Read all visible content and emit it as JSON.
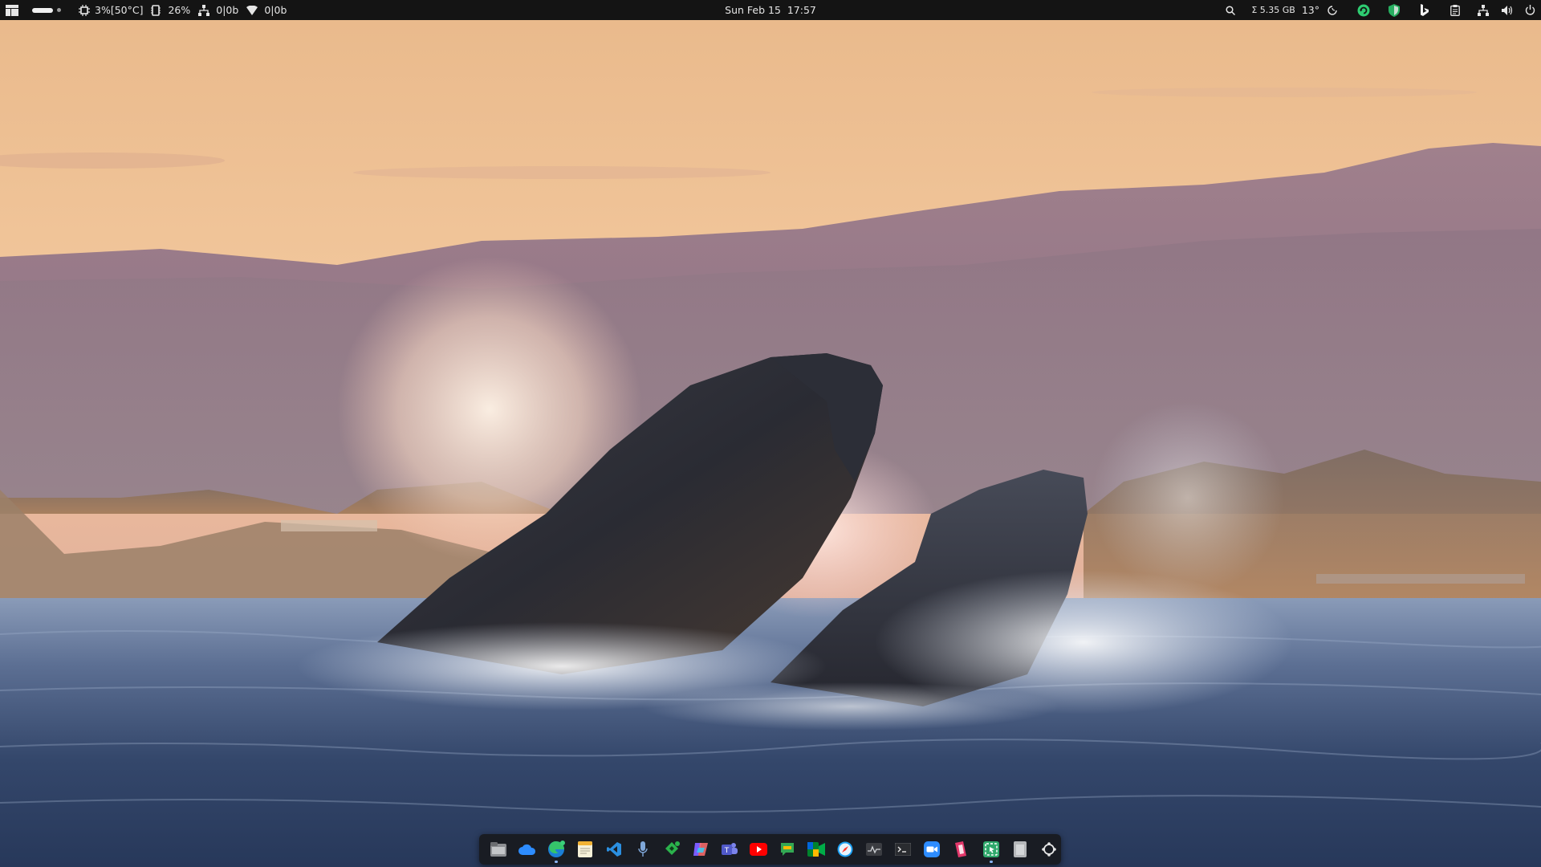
{
  "top_panel": {
    "cpu_usage": "3%[50°C]",
    "memory_usage": "26%",
    "network_speed": "0|0b",
    "wifi_speed": "0|0b",
    "datetime": "Sun Feb 15  17:57",
    "disk_usage": "Σ 5.35 GB",
    "weather_temp": "13°"
  },
  "icons": {
    "app_menu": "layout-icon",
    "workspace": "workspace-indicator",
    "cpu": "cpu-icon",
    "memory": "memory-icon",
    "network": "network-icon",
    "wifi": "wifi-icon",
    "search": "search-icon",
    "night_light": "night-light-icon",
    "sync": "sync-icon",
    "shield": "shield-icon",
    "bing": "bing-icon",
    "clipboard": "clipboard-icon",
    "volume": "volume-icon",
    "power": "power-icon"
  },
  "dock": {
    "items": [
      {
        "name": "files",
        "active": false
      },
      {
        "name": "onedrive",
        "active": false
      },
      {
        "name": "edge",
        "active": true
      },
      {
        "name": "notes",
        "active": false
      },
      {
        "name": "vscode",
        "active": false
      },
      {
        "name": "voice-recorder",
        "active": false
      },
      {
        "name": "feedly",
        "active": false
      },
      {
        "name": "copilot",
        "active": false
      },
      {
        "name": "teams",
        "active": false
      },
      {
        "name": "youtube",
        "active": false
      },
      {
        "name": "chat",
        "active": false
      },
      {
        "name": "meet",
        "active": false
      },
      {
        "name": "safari",
        "active": false
      },
      {
        "name": "system-monitor",
        "active": false
      },
      {
        "name": "terminal",
        "active": false
      },
      {
        "name": "zoom",
        "active": false
      },
      {
        "name": "pinta",
        "active": false
      },
      {
        "name": "screenshot",
        "active": true
      },
      {
        "name": "trash",
        "active": false
      },
      {
        "name": "show-apps",
        "active": false
      }
    ]
  },
  "colors": {
    "panel_bg": "#141414",
    "dock_bg": "#181a1e",
    "accent": "#8ab4f8"
  }
}
